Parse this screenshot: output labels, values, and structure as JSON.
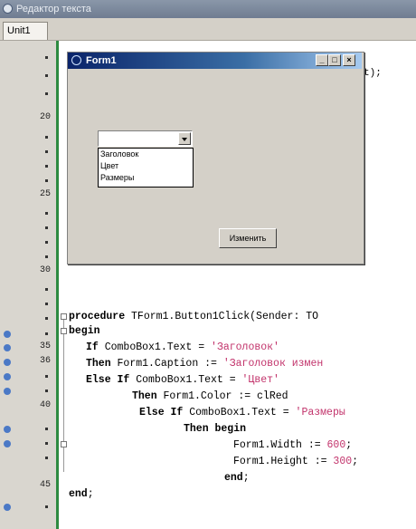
{
  "ide": {
    "title": "Редактор текста",
    "tab": "Unit1"
  },
  "gutter": {
    "line_numbers": [
      "20",
      "25",
      "30",
      "35",
      "36",
      "40",
      "45"
    ]
  },
  "form_window": {
    "caption": "Form1",
    "minimize": "_",
    "maximize": "□",
    "close": "×",
    "combobox_value": "",
    "dropdown_items": [
      "Заголовок",
      "Цвет",
      "Размеры"
    ],
    "button_label": "Изменить"
  },
  "behind_code": "t);",
  "code": {
    "line1": {
      "kw": "procedure",
      "rest": " TForm1.Button1Click(Sender: TO"
    },
    "line2": {
      "kw": "begin"
    },
    "line3": {
      "kw": "If",
      "mid": " ComboBox1.Text = ",
      "str": "'Заголовок'"
    },
    "line4": {
      "kw": "Then",
      "mid": " Form1.Caption := ",
      "str": "'Заголовок измен"
    },
    "line5": {
      "kw": "Else If",
      "mid": " ComboBox1.Text = ",
      "str": "'Цвет'"
    },
    "line6": {
      "kw": "Then",
      "mid": " Form1.Color := clRed"
    },
    "line7": {
      "kw": "Else If",
      "mid": " ComboBox1.Text = ",
      "str": "'Размеры"
    },
    "line8": {
      "kw": "Then begin"
    },
    "line9": {
      "mid": "Form1.Width := ",
      "str": "600",
      "tail": ";"
    },
    "line10": {
      "mid": "Form1.Height := ",
      "str": "300",
      "tail": ";"
    },
    "line11": {
      "kw": "end",
      "tail": ";"
    },
    "line12": {
      "kw": "end",
      "tail": ";"
    }
  }
}
